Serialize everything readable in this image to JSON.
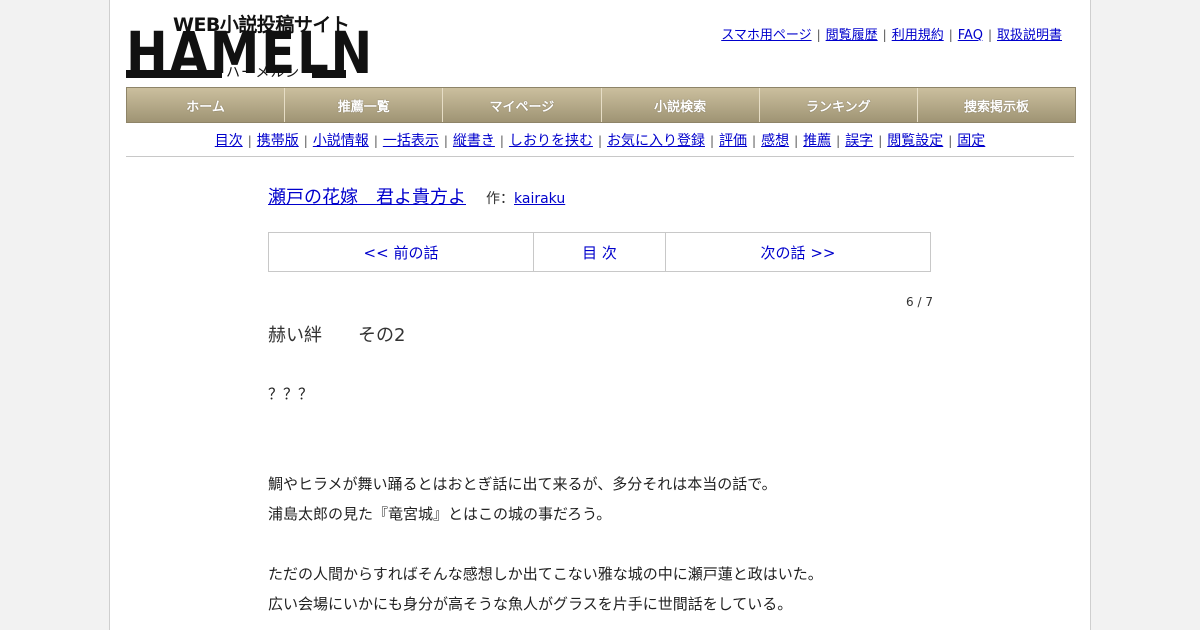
{
  "logo": {
    "tagline": "WEB小説投稿サイト",
    "wordmark": "HAMELN",
    "kana": "ハーメルン"
  },
  "top_links": [
    "スマホ用ページ",
    "閲覧履歴",
    "利用規約",
    "FAQ",
    "取扱説明書"
  ],
  "main_nav": [
    "ホーム",
    "推薦一覧",
    "マイページ",
    "小説検索",
    "ランキング",
    "捜索掲示板"
  ],
  "sub_nav": [
    "目次",
    "携帯版",
    "小説情報",
    "一括表示",
    "縦書き",
    "しおりを挟む",
    "お気に入り登録",
    "評価",
    "感想",
    "推薦",
    "誤字",
    "閲覧設定",
    "固定"
  ],
  "story": {
    "title": "瀬戸の花嫁　君よ貴方よ",
    "author_prefix": "作：",
    "author": "kairaku"
  },
  "pager": {
    "prev": "<< 前の話",
    "toc": "目 次",
    "next": "次の話 >>"
  },
  "counter": "6 / 7",
  "chapter_title": "赫い絆　　その2",
  "body_lines": [
    "？？？",
    "",
    "",
    "鯛やヒラメが舞い踊るとはおとぎ話に出て来るが、多分それは本当の話で。",
    "浦島太郎の見た『竜宮城』とはこの城の事だろう。",
    "",
    "ただの人間からすればそんな感想しか出てこない雅な城の中に瀬戸蓮と政はいた。",
    "広い会場にいかにも身分が高そうな魚人がグラスを片手に世間話をしている。"
  ]
}
